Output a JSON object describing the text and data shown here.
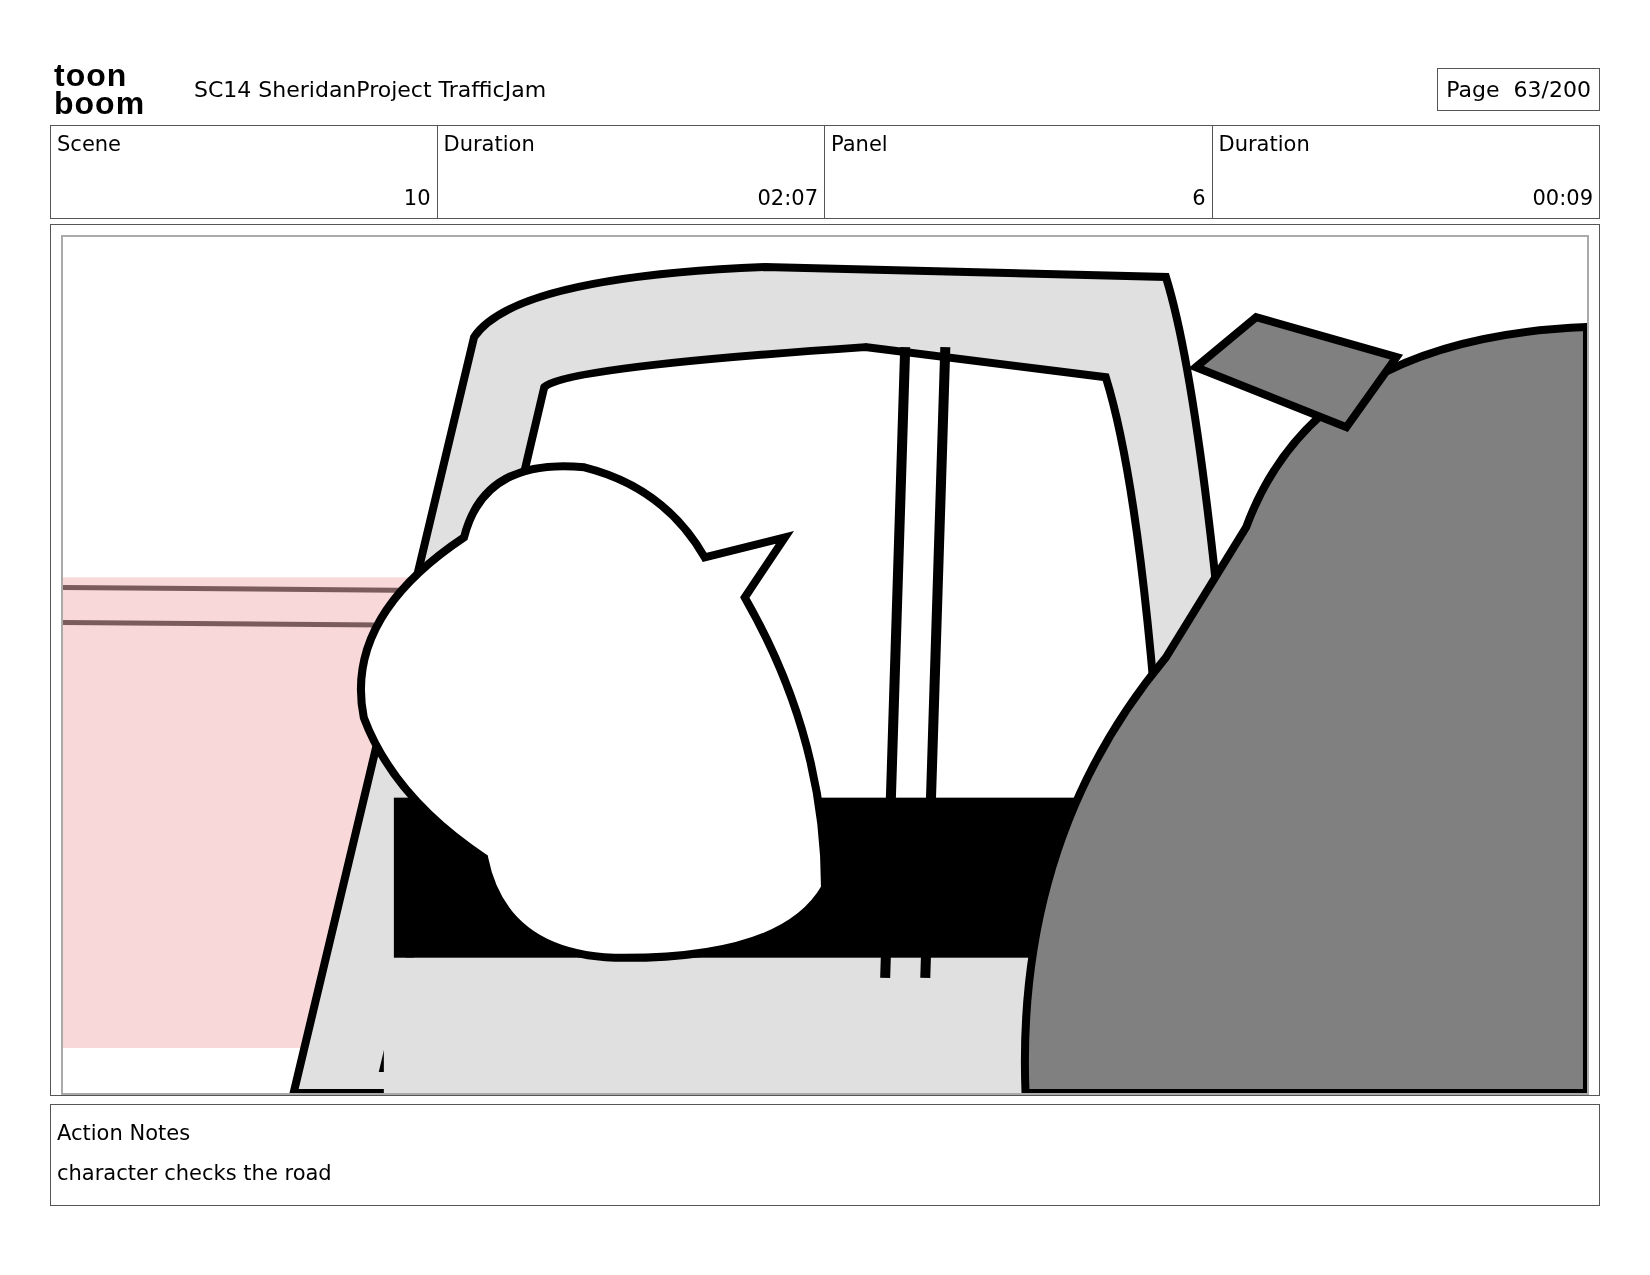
{
  "logo": [
    "toon",
    "boom"
  ],
  "title": "SC14 SheridanProject TrafficJam",
  "page": {
    "label": "Page",
    "value": "63/200"
  },
  "info_table": {
    "columns": [
      "Scene",
      "Duration",
      "Panel",
      "Duration"
    ],
    "row": [
      "10",
      "02:07",
      "6",
      "00:09"
    ]
  },
  "notes": {
    "label": "Action Notes",
    "text": "character checks the road"
  }
}
